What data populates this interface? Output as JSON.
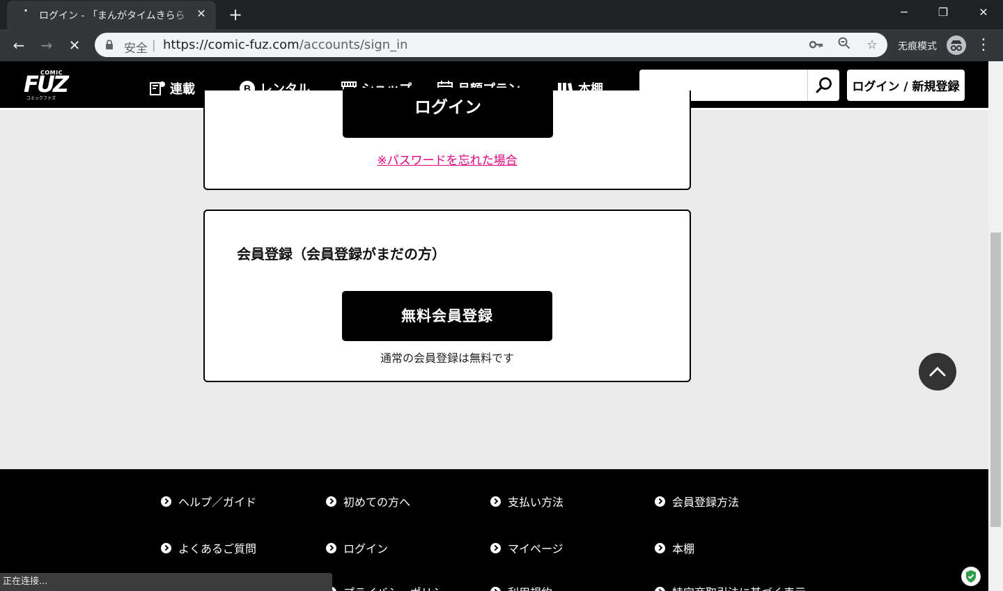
{
  "browser": {
    "tab_title": "ログイン - 「まんがタイムきらら",
    "new_tab_label": "+",
    "address": {
      "secure_label": "安全",
      "url_host": "https://comic-fuz.com",
      "url_path": "/accounts/sign_in"
    },
    "incognito_label": "无痕模式",
    "status_text": "正在连接..."
  },
  "site": {
    "logo": {
      "top": "COMIC",
      "main": "FUZ",
      "sub": "コミックファズ"
    },
    "nav": [
      {
        "label": "連載",
        "icon": "serial-icon"
      },
      {
        "label": "レンタル",
        "icon": "rental-icon"
      },
      {
        "label": "ショップ",
        "icon": "shop-icon"
      },
      {
        "label": "月額プラン",
        "icon": "calendar-icon"
      },
      {
        "label": "本棚",
        "icon": "bookshelf-icon"
      }
    ],
    "search": {
      "placeholder": ""
    },
    "login_register_label": "ログイン / 新規登録"
  },
  "login_card": {
    "submit_label": "ログイン",
    "forgot_link": "※パスワードを忘れた場合"
  },
  "register_card": {
    "heading": "会員登録（会員登録がまだの方）",
    "button_label": "無料会員登録",
    "note": "通常の会員登録は無料です"
  },
  "footer": {
    "links": [
      "ヘルプ／ガイド",
      "初めての方へ",
      "支払い方法",
      "会員登録方法",
      "よくあるご質問",
      "ログイン",
      "マイページ",
      "本棚",
      "プライバシーポリシー",
      "利用規約",
      "特定商取引法に基づく表示"
    ]
  }
}
